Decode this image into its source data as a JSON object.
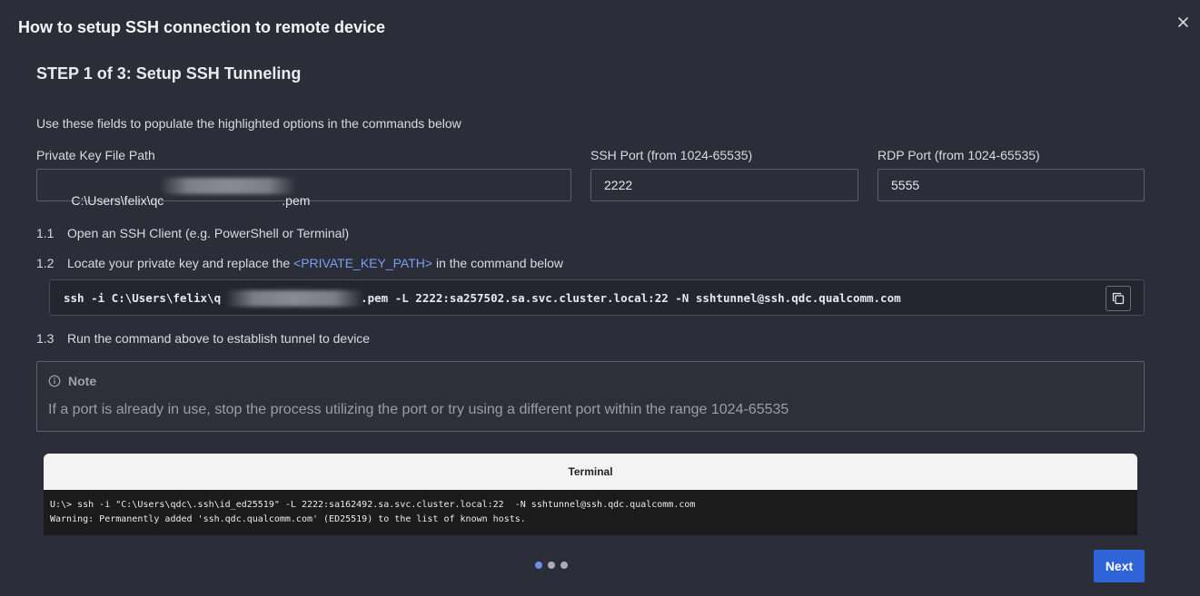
{
  "dialog": {
    "title": "How to setup SSH connection to remote device",
    "close_icon": "close-icon"
  },
  "step": {
    "title": "STEP 1 of 3: Setup SSH Tunneling",
    "instructions": "Use these fields to populate the highlighted options in the commands below"
  },
  "fields": {
    "private_key": {
      "label": "Private Key File Path",
      "value_start": "C:\\Users\\felix\\qc",
      "value_end": ".pem"
    },
    "ssh_port": {
      "label": "SSH Port (from 1024-65535)",
      "value": "2222"
    },
    "rdp_port": {
      "label": "RDP Port (from 1024-65535)",
      "value": "5555"
    }
  },
  "steps": [
    {
      "num": "1.1",
      "text": "Open an SSH Client (e.g. PowerShell or Terminal)"
    },
    {
      "num": "1.2",
      "text_before": "Locate your private key and replace the ",
      "highlight": "<PRIVATE_KEY_PATH>",
      "text_after": " in the command below"
    },
    {
      "num": "1.3",
      "text": "Run the command above to establish tunnel to device"
    }
  ],
  "command": {
    "prefix": "ssh -i C:\\Users\\felix\\q",
    "suffix": ".pem -L 2222:sa257502.sa.svc.cluster.local:22 -N sshtunnel@ssh.qdc.qualcomm.com",
    "copy_icon": "copy-icon"
  },
  "note": {
    "title": "Note",
    "icon": "info-icon",
    "text": "If a port is already in use, stop the process utilizing the port or try using a different port within the range 1024-65535"
  },
  "terminal": {
    "title": "Terminal",
    "lines": [
      "U:\\> ssh -i \"C:\\Users\\qdc\\.ssh\\id_ed25519\" -L 2222:sa162492.sa.svc.cluster.local:22  -N sshtunnel@ssh.qdc.qualcomm.com",
      "Warning: Permanently added 'ssh.qdc.qualcomm.com' (ED25519) to the list of known hosts."
    ]
  },
  "pagination": {
    "current": 1,
    "total": 3
  },
  "footer": {
    "next_label": "Next"
  },
  "colors": {
    "background": "#2b2e38",
    "accent": "#2f63d8",
    "highlight": "#7b9ff2"
  }
}
